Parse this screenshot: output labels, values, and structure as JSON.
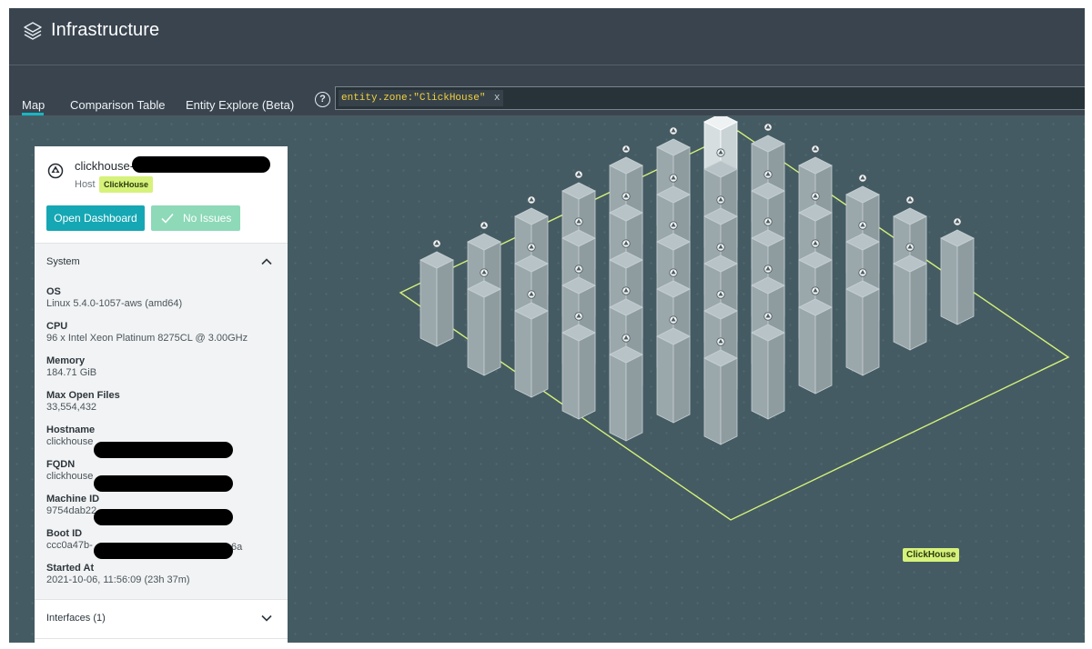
{
  "app": {
    "title": "Infrastructure",
    "icon": "layers-icon"
  },
  "tabs": [
    {
      "label": "Map",
      "active": true
    },
    {
      "label": "Comparison Table",
      "active": false
    },
    {
      "label": "Entity Explore (Beta)",
      "active": false
    }
  ],
  "search": {
    "help_icon": "question-circle-icon",
    "help_glyph": "?",
    "filter_chip": "entity.zone:\"ClickHouse\"",
    "chip_close": "x"
  },
  "entity": {
    "icon": "clickhouse-host-icon",
    "name_prefix": "clickhouse-",
    "type": "Host",
    "zone_tag": "ClickHouse",
    "open_dashboard_label": "Open Dashboard",
    "issues_label": "No Issues"
  },
  "system": {
    "title": "System",
    "expanded": true,
    "properties": [
      {
        "label": "OS",
        "value": "Linux 5.4.0-1057-aws (amd64)"
      },
      {
        "label": "CPU",
        "value": "96 x Intel Xeon Platinum 8275CL @ 3.00GHz"
      },
      {
        "label": "Memory",
        "value": "184.71 GiB"
      },
      {
        "label": "Max Open Files",
        "value": "33,554,432"
      },
      {
        "label": "Hostname",
        "value": "clickhouse"
      },
      {
        "label": "FQDN",
        "value": "clickhouse"
      },
      {
        "label": "Machine ID",
        "value": "9754dab22"
      },
      {
        "label": "Boot ID",
        "value": "ccc0a47b-",
        "value_suffix": "6a"
      },
      {
        "label": "Started At",
        "value": "2021-10-06, 11:56:09 (23h 37m)"
      }
    ]
  },
  "interfaces": {
    "title": "Interfaces (1)",
    "expanded": false
  },
  "map": {
    "zone_label": "ClickHouse",
    "zone_color": "#d6f27a",
    "background": "#445b63"
  },
  "colors": {
    "accent": "#15a7b4",
    "success": "#8dd9b8",
    "tag": "#d6f27a",
    "header": "#39444f"
  }
}
